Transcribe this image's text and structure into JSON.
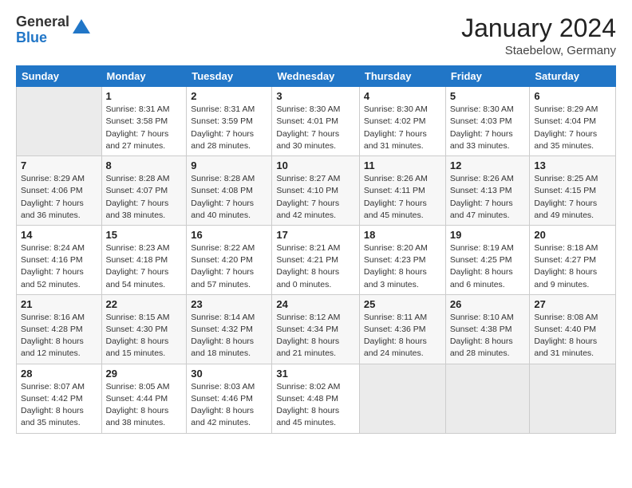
{
  "header": {
    "logo_general": "General",
    "logo_blue": "Blue",
    "month": "January 2024",
    "location": "Staebelow, Germany"
  },
  "weekdays": [
    "Sunday",
    "Monday",
    "Tuesday",
    "Wednesday",
    "Thursday",
    "Friday",
    "Saturday"
  ],
  "weeks": [
    [
      {
        "day": "",
        "sunrise": "",
        "sunset": "",
        "daylight": ""
      },
      {
        "day": "1",
        "sunrise": "Sunrise: 8:31 AM",
        "sunset": "Sunset: 3:58 PM",
        "daylight": "Daylight: 7 hours and 27 minutes."
      },
      {
        "day": "2",
        "sunrise": "Sunrise: 8:31 AM",
        "sunset": "Sunset: 3:59 PM",
        "daylight": "Daylight: 7 hours and 28 minutes."
      },
      {
        "day": "3",
        "sunrise": "Sunrise: 8:30 AM",
        "sunset": "Sunset: 4:01 PM",
        "daylight": "Daylight: 7 hours and 30 minutes."
      },
      {
        "day": "4",
        "sunrise": "Sunrise: 8:30 AM",
        "sunset": "Sunset: 4:02 PM",
        "daylight": "Daylight: 7 hours and 31 minutes."
      },
      {
        "day": "5",
        "sunrise": "Sunrise: 8:30 AM",
        "sunset": "Sunset: 4:03 PM",
        "daylight": "Daylight: 7 hours and 33 minutes."
      },
      {
        "day": "6",
        "sunrise": "Sunrise: 8:29 AM",
        "sunset": "Sunset: 4:04 PM",
        "daylight": "Daylight: 7 hours and 35 minutes."
      }
    ],
    [
      {
        "day": "7",
        "sunrise": "Sunrise: 8:29 AM",
        "sunset": "Sunset: 4:06 PM",
        "daylight": "Daylight: 7 hours and 36 minutes."
      },
      {
        "day": "8",
        "sunrise": "Sunrise: 8:28 AM",
        "sunset": "Sunset: 4:07 PM",
        "daylight": "Daylight: 7 hours and 38 minutes."
      },
      {
        "day": "9",
        "sunrise": "Sunrise: 8:28 AM",
        "sunset": "Sunset: 4:08 PM",
        "daylight": "Daylight: 7 hours and 40 minutes."
      },
      {
        "day": "10",
        "sunrise": "Sunrise: 8:27 AM",
        "sunset": "Sunset: 4:10 PM",
        "daylight": "Daylight: 7 hours and 42 minutes."
      },
      {
        "day": "11",
        "sunrise": "Sunrise: 8:26 AM",
        "sunset": "Sunset: 4:11 PM",
        "daylight": "Daylight: 7 hours and 45 minutes."
      },
      {
        "day": "12",
        "sunrise": "Sunrise: 8:26 AM",
        "sunset": "Sunset: 4:13 PM",
        "daylight": "Daylight: 7 hours and 47 minutes."
      },
      {
        "day": "13",
        "sunrise": "Sunrise: 8:25 AM",
        "sunset": "Sunset: 4:15 PM",
        "daylight": "Daylight: 7 hours and 49 minutes."
      }
    ],
    [
      {
        "day": "14",
        "sunrise": "Sunrise: 8:24 AM",
        "sunset": "Sunset: 4:16 PM",
        "daylight": "Daylight: 7 hours and 52 minutes."
      },
      {
        "day": "15",
        "sunrise": "Sunrise: 8:23 AM",
        "sunset": "Sunset: 4:18 PM",
        "daylight": "Daylight: 7 hours and 54 minutes."
      },
      {
        "day": "16",
        "sunrise": "Sunrise: 8:22 AM",
        "sunset": "Sunset: 4:20 PM",
        "daylight": "Daylight: 7 hours and 57 minutes."
      },
      {
        "day": "17",
        "sunrise": "Sunrise: 8:21 AM",
        "sunset": "Sunset: 4:21 PM",
        "daylight": "Daylight: 8 hours and 0 minutes."
      },
      {
        "day": "18",
        "sunrise": "Sunrise: 8:20 AM",
        "sunset": "Sunset: 4:23 PM",
        "daylight": "Daylight: 8 hours and 3 minutes."
      },
      {
        "day": "19",
        "sunrise": "Sunrise: 8:19 AM",
        "sunset": "Sunset: 4:25 PM",
        "daylight": "Daylight: 8 hours and 6 minutes."
      },
      {
        "day": "20",
        "sunrise": "Sunrise: 8:18 AM",
        "sunset": "Sunset: 4:27 PM",
        "daylight": "Daylight: 8 hours and 9 minutes."
      }
    ],
    [
      {
        "day": "21",
        "sunrise": "Sunrise: 8:16 AM",
        "sunset": "Sunset: 4:28 PM",
        "daylight": "Daylight: 8 hours and 12 minutes."
      },
      {
        "day": "22",
        "sunrise": "Sunrise: 8:15 AM",
        "sunset": "Sunset: 4:30 PM",
        "daylight": "Daylight: 8 hours and 15 minutes."
      },
      {
        "day": "23",
        "sunrise": "Sunrise: 8:14 AM",
        "sunset": "Sunset: 4:32 PM",
        "daylight": "Daylight: 8 hours and 18 minutes."
      },
      {
        "day": "24",
        "sunrise": "Sunrise: 8:12 AM",
        "sunset": "Sunset: 4:34 PM",
        "daylight": "Daylight: 8 hours and 21 minutes."
      },
      {
        "day": "25",
        "sunrise": "Sunrise: 8:11 AM",
        "sunset": "Sunset: 4:36 PM",
        "daylight": "Daylight: 8 hours and 24 minutes."
      },
      {
        "day": "26",
        "sunrise": "Sunrise: 8:10 AM",
        "sunset": "Sunset: 4:38 PM",
        "daylight": "Daylight: 8 hours and 28 minutes."
      },
      {
        "day": "27",
        "sunrise": "Sunrise: 8:08 AM",
        "sunset": "Sunset: 4:40 PM",
        "daylight": "Daylight: 8 hours and 31 minutes."
      }
    ],
    [
      {
        "day": "28",
        "sunrise": "Sunrise: 8:07 AM",
        "sunset": "Sunset: 4:42 PM",
        "daylight": "Daylight: 8 hours and 35 minutes."
      },
      {
        "day": "29",
        "sunrise": "Sunrise: 8:05 AM",
        "sunset": "Sunset: 4:44 PM",
        "daylight": "Daylight: 8 hours and 38 minutes."
      },
      {
        "day": "30",
        "sunrise": "Sunrise: 8:03 AM",
        "sunset": "Sunset: 4:46 PM",
        "daylight": "Daylight: 8 hours and 42 minutes."
      },
      {
        "day": "31",
        "sunrise": "Sunrise: 8:02 AM",
        "sunset": "Sunset: 4:48 PM",
        "daylight": "Daylight: 8 hours and 45 minutes."
      },
      {
        "day": "",
        "sunrise": "",
        "sunset": "",
        "daylight": ""
      },
      {
        "day": "",
        "sunrise": "",
        "sunset": "",
        "daylight": ""
      },
      {
        "day": "",
        "sunrise": "",
        "sunset": "",
        "daylight": ""
      }
    ]
  ]
}
